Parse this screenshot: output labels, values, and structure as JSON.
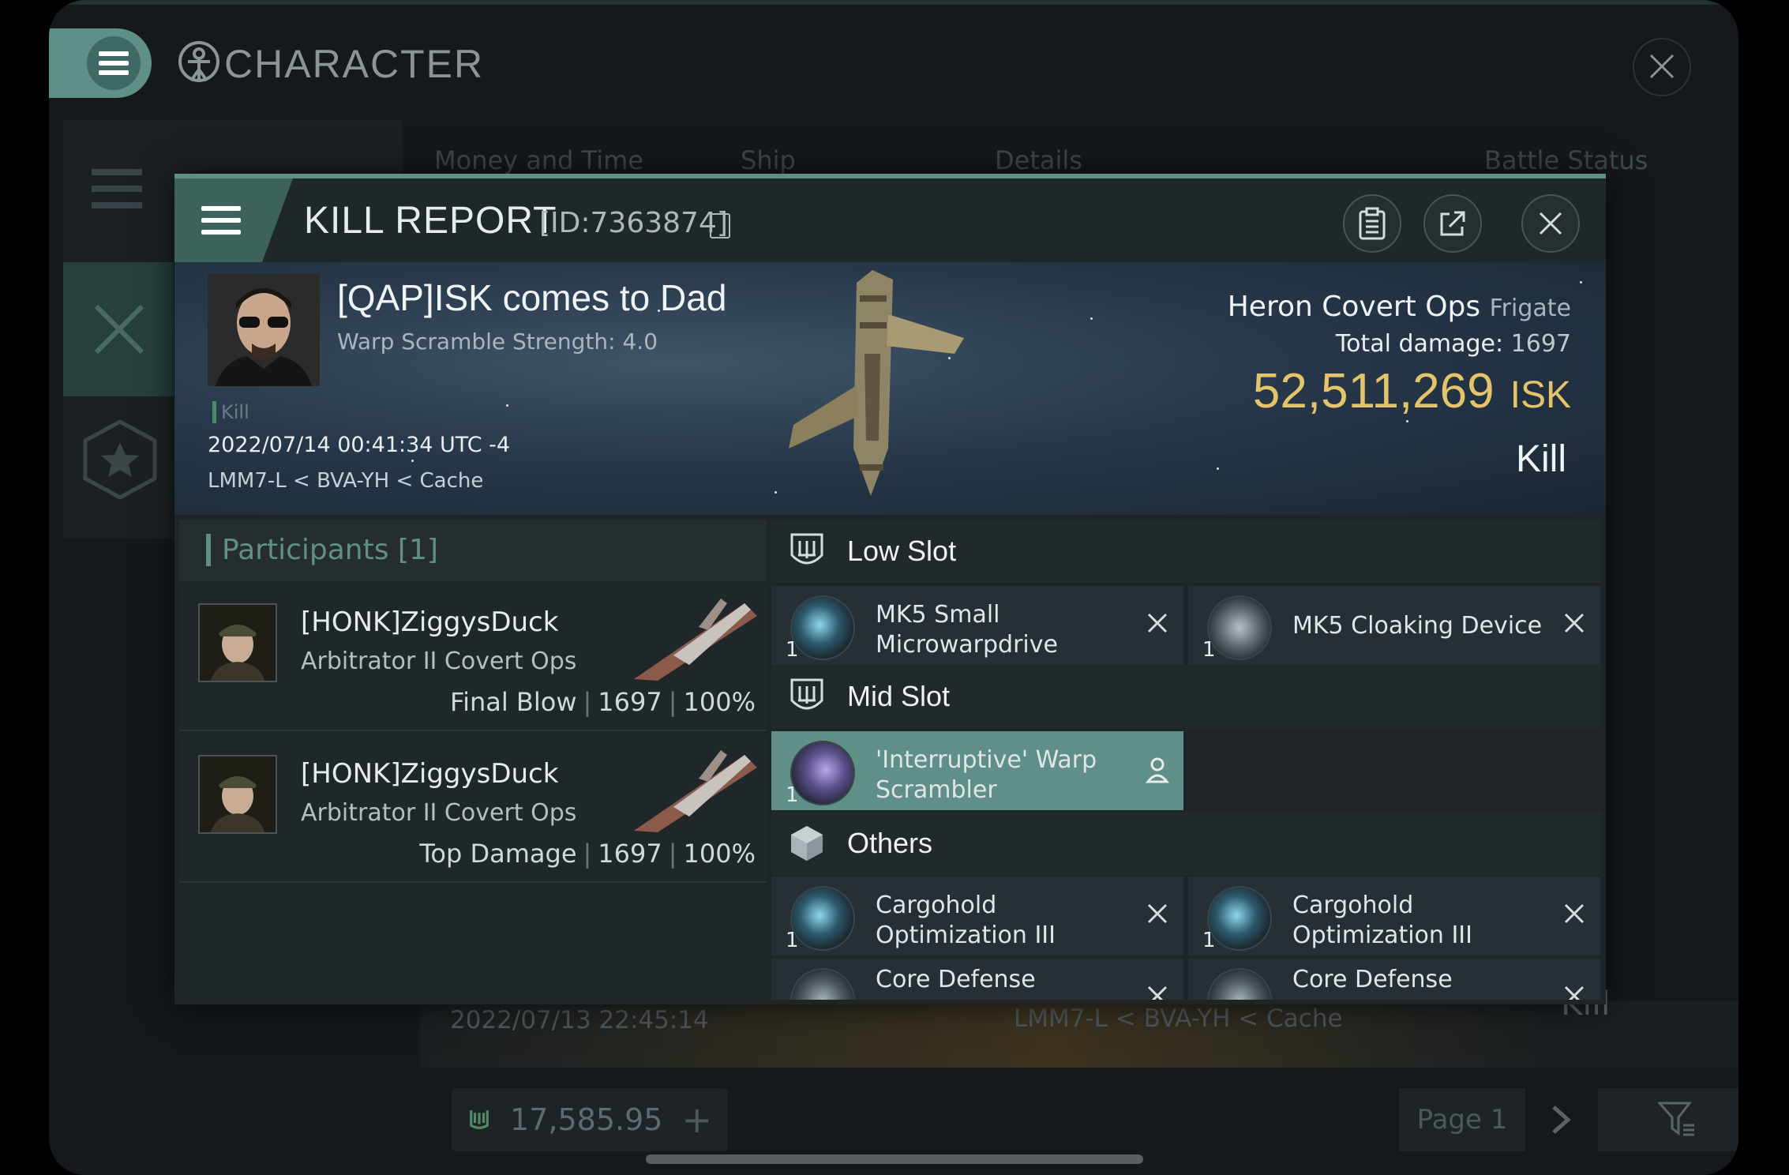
{
  "background_window": {
    "title": "CHARACTER",
    "tabs": [
      "Money and Time",
      "Ship",
      "Details",
      "Battle Status"
    ],
    "row_date": "2022/07/13  22:45:14",
    "row_location": "LMM7-L < BVA-YH < Cache",
    "row_result": "Kill",
    "wallet_value": "17,585.95",
    "page_label": "Page 1"
  },
  "kill_report": {
    "title": "KILL REPORT",
    "id_label": "[ID:7363874]",
    "victim": {
      "name": "[QAP]ISK comes to Dad",
      "warp_scramble": "Warp Scramble Strength: 4.0",
      "tag": "Kill",
      "datetime": "2022/07/14 00:41:34 UTC -4",
      "location": "LMM7-L < BVA-YH < Cache",
      "ship_name": "Heron Covert Ops",
      "ship_class": "Frigate",
      "total_damage_label": "Total damage:",
      "total_damage_value": "1697",
      "isk_value": "52,511,269",
      "isk_unit": "ISK",
      "result": "Kill"
    },
    "participants": {
      "header": "Participants [1]",
      "rows": [
        {
          "name": "[HONK]ZiggysDuck",
          "ship": "Arbitrator II Covert Ops",
          "role": "Final Blow",
          "damage": "1697",
          "percent": "100%"
        },
        {
          "name": "[HONK]ZiggysDuck",
          "ship": "Arbitrator II Covert Ops",
          "role": "Top Damage",
          "damage": "1697",
          "percent": "100%"
        }
      ]
    },
    "slots": {
      "low_label": "Low Slot",
      "low_items": [
        {
          "qty": "1",
          "name": "MK5 Small Microwarpdrive"
        },
        {
          "qty": "1",
          "name": "MK5 Cloaking Device"
        }
      ],
      "mid_label": "Mid Slot",
      "mid_items": [
        {
          "qty": "1",
          "name": "'Interruptive' Warp Scrambler"
        }
      ],
      "others_label": "Others",
      "other_items": [
        {
          "qty": "1",
          "name": "Cargohold Optimization III"
        },
        {
          "qty": "1",
          "name": "Cargohold Optimization III"
        },
        {
          "qty": "",
          "name": "Core Defense"
        },
        {
          "qty": "",
          "name": "Core Defense"
        }
      ]
    }
  },
  "colors": {
    "accent": "#5f8f86",
    "isk": "#e3c46a",
    "panel": "#1e2427"
  }
}
